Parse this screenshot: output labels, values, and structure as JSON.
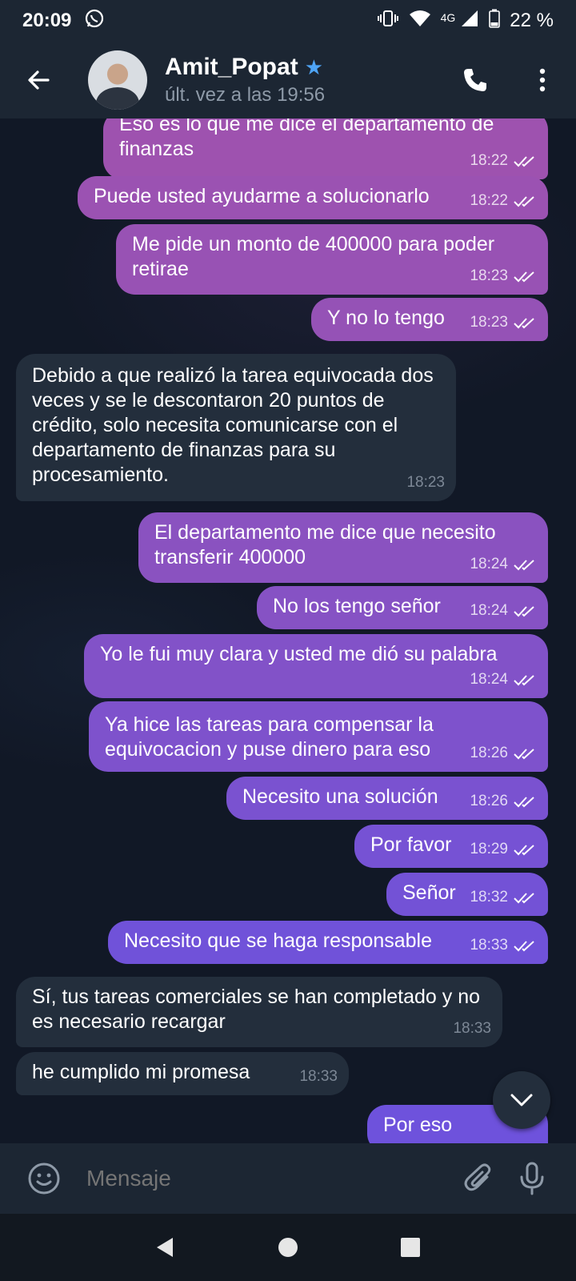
{
  "status_bar": {
    "time": "20:09",
    "network": "4G",
    "battery": "22 %",
    "icons": [
      "whatsapp-icon",
      "vibrate-icon",
      "wifi-icon",
      "signal-icon",
      "battery-icon"
    ]
  },
  "header": {
    "name": "Amit_Popat",
    "last_seen": "últ. vez a las 19:56",
    "icons": [
      "back-arrow-icon",
      "star-icon",
      "phone-icon",
      "more-vertical-icon"
    ]
  },
  "messages": [
    {
      "dir": "out",
      "text": "Eso es lo que me dice el departamento de finanzas",
      "time": "18:22"
    },
    {
      "dir": "out",
      "text": "Puede usted ayudarme a solucionarlo",
      "time": "18:22"
    },
    {
      "dir": "out",
      "text": "Me pide un monto de 400000 para poder retirae",
      "time": "18:23"
    },
    {
      "dir": "out",
      "text": "Y no lo tengo",
      "time": "18:23"
    },
    {
      "dir": "in",
      "text": "Debido a que realizó la tarea equivocada dos veces y se le descontaron 20 puntos de crédito, solo necesita comunicarse con el departamento de finanzas para su procesamiento.",
      "time": "18:23"
    },
    {
      "dir": "out",
      "text": "El departamento me dice que necesito transferir 400000",
      "time": "18:24"
    },
    {
      "dir": "out",
      "text": "No los tengo señor",
      "time": "18:24"
    },
    {
      "dir": "out",
      "text": "Yo le fui muy clara y usted me dió su palabra",
      "time": "18:24"
    },
    {
      "dir": "out",
      "text": "Ya hice las tareas para compensar la equivocacion y puse dinero para eso",
      "time": "18:26"
    },
    {
      "dir": "out",
      "text": "Necesito una solución",
      "time": "18:26"
    },
    {
      "dir": "out",
      "text": "Por favor",
      "time": "18:29"
    },
    {
      "dir": "out",
      "text": "Señor",
      "time": "18:32"
    },
    {
      "dir": "out",
      "text": "Necesito que se haga responsable",
      "time": "18:33"
    },
    {
      "dir": "in",
      "text": "Sí, tus tareas comerciales se han completado y no es necesario recargar",
      "time": "18:33"
    },
    {
      "dir": "in",
      "text": "he cumplido mi promesa",
      "time": "18:33"
    },
    {
      "dir": "out",
      "text": "Por eso",
      "time": ""
    }
  ],
  "input": {
    "placeholder": "Mensaje",
    "icons": [
      "emoji-icon",
      "attach-icon",
      "mic-icon"
    ]
  },
  "colors": {
    "header_bg": "#1c2633",
    "chat_bg": "#111826",
    "incoming_bubble": "#232e3c",
    "outgoing_top": "#9c52b0",
    "outgoing_bottom": "#6f52dc",
    "verified_star": "#4ea4f6"
  }
}
